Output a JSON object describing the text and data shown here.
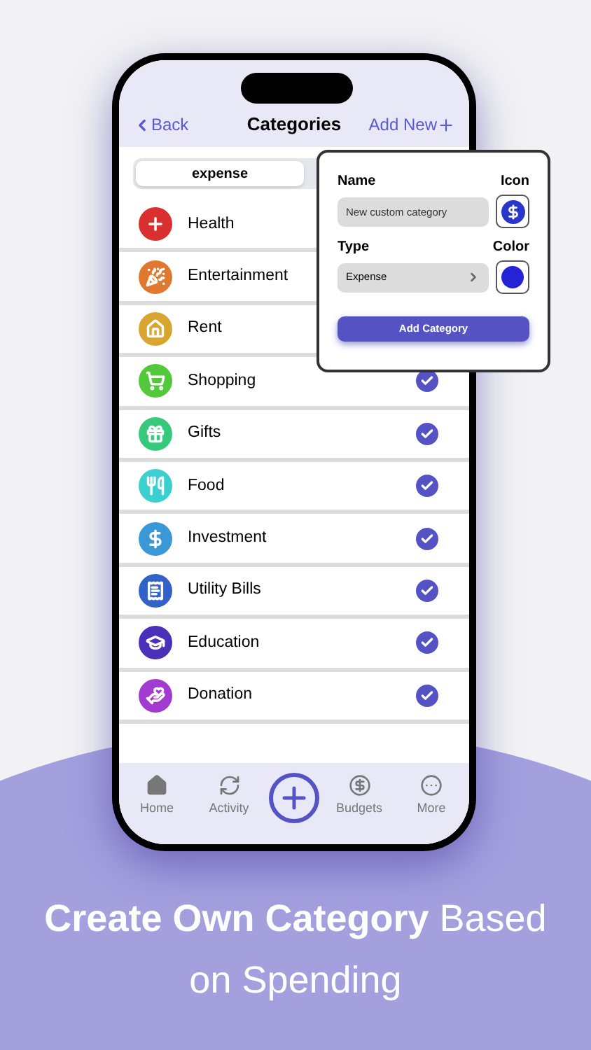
{
  "header": {
    "back": "Back",
    "title": "Categories",
    "add_new": "Add New"
  },
  "tabs": [
    {
      "label": "expense",
      "selected": true
    }
  ],
  "categories": [
    {
      "name": "Health",
      "color": "#d9302f"
    },
    {
      "name": "Entertainment",
      "color": "#e0792f"
    },
    {
      "name": "Rent",
      "color": "#d9a531"
    },
    {
      "name": "Shopping",
      "color": "#52c93a",
      "checked": true
    },
    {
      "name": "Gifts",
      "color": "#35c97c",
      "checked": true
    },
    {
      "name": "Food",
      "color": "#3ccfcf",
      "checked": true
    },
    {
      "name": "Investment",
      "color": "#3a98d6",
      "checked": true
    },
    {
      "name": "Utility Bills",
      "color": "#3262c8",
      "checked": true
    },
    {
      "name": "Education",
      "color": "#4a2fb8",
      "checked": true
    },
    {
      "name": "Donation",
      "color": "#a23bd0",
      "checked": true
    }
  ],
  "popup": {
    "name_label": "Name",
    "name_placeholder": "New custom category",
    "icon_label": "Icon",
    "type_label": "Type",
    "type_value": "Expense",
    "color_label": "Color",
    "color": "#2424d6",
    "button": "Add Category"
  },
  "tab_bar": [
    {
      "kind": "tab",
      "label": "Home"
    },
    {
      "kind": "tab",
      "label": "Activity"
    },
    {
      "kind": "add"
    },
    {
      "kind": "tab",
      "label": "Budgets"
    },
    {
      "kind": "tab",
      "label": "More"
    }
  ],
  "caption": "**Create Own Category** Based on Spending"
}
